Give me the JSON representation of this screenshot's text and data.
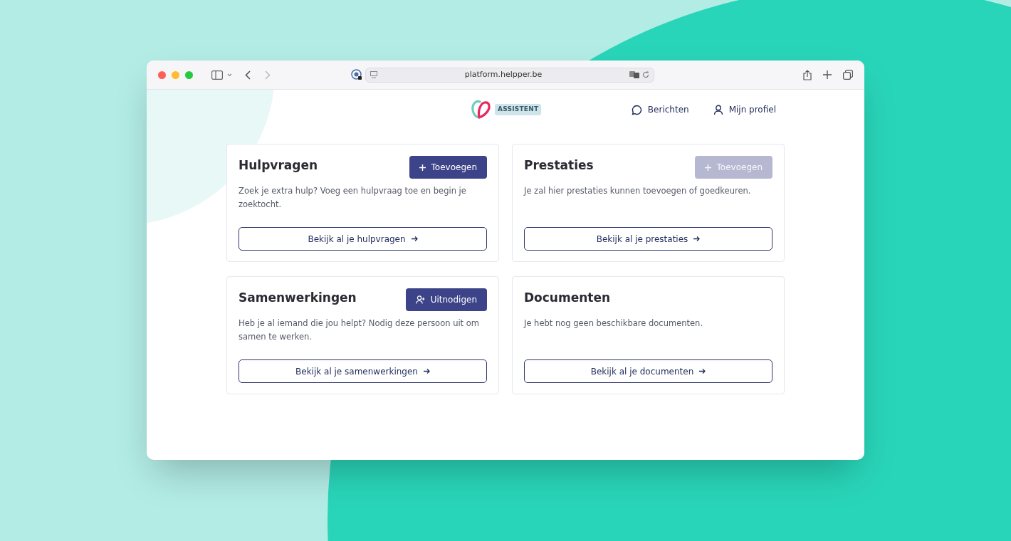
{
  "browser": {
    "url": "platform.helpper.be"
  },
  "header": {
    "badge": "ASSISTENT",
    "nav": [
      {
        "kind": "messages",
        "label": "Berichten"
      },
      {
        "kind": "profile",
        "label": "Mijn profiel"
      }
    ]
  },
  "cards": [
    {
      "title": "Hulpvragen",
      "action": {
        "kind": "add",
        "label": "Toevoegen",
        "disabled": false
      },
      "description": "Zoek je extra hulp? Voeg een hulpvraag toe en begin je zoektocht.",
      "link": "Bekijk al je hulpvragen"
    },
    {
      "title": "Prestaties",
      "action": {
        "kind": "add",
        "label": "Toevoegen",
        "disabled": true
      },
      "description": "Je zal hier prestaties kunnen toevoegen of goedkeuren.",
      "link": "Bekijk al je prestaties"
    },
    {
      "title": "Samenwerkingen",
      "action": {
        "kind": "invite",
        "label": "Uitnodigen",
        "disabled": false
      },
      "description": "Heb je al iemand die jou helpt? Nodig deze persoon uit om samen te werken.",
      "link": "Bekijk al je samenwerkingen"
    },
    {
      "title": "Documenten",
      "description": "Je hebt nog geen beschikbare documenten.",
      "link": "Bekijk al je documenten"
    }
  ]
}
